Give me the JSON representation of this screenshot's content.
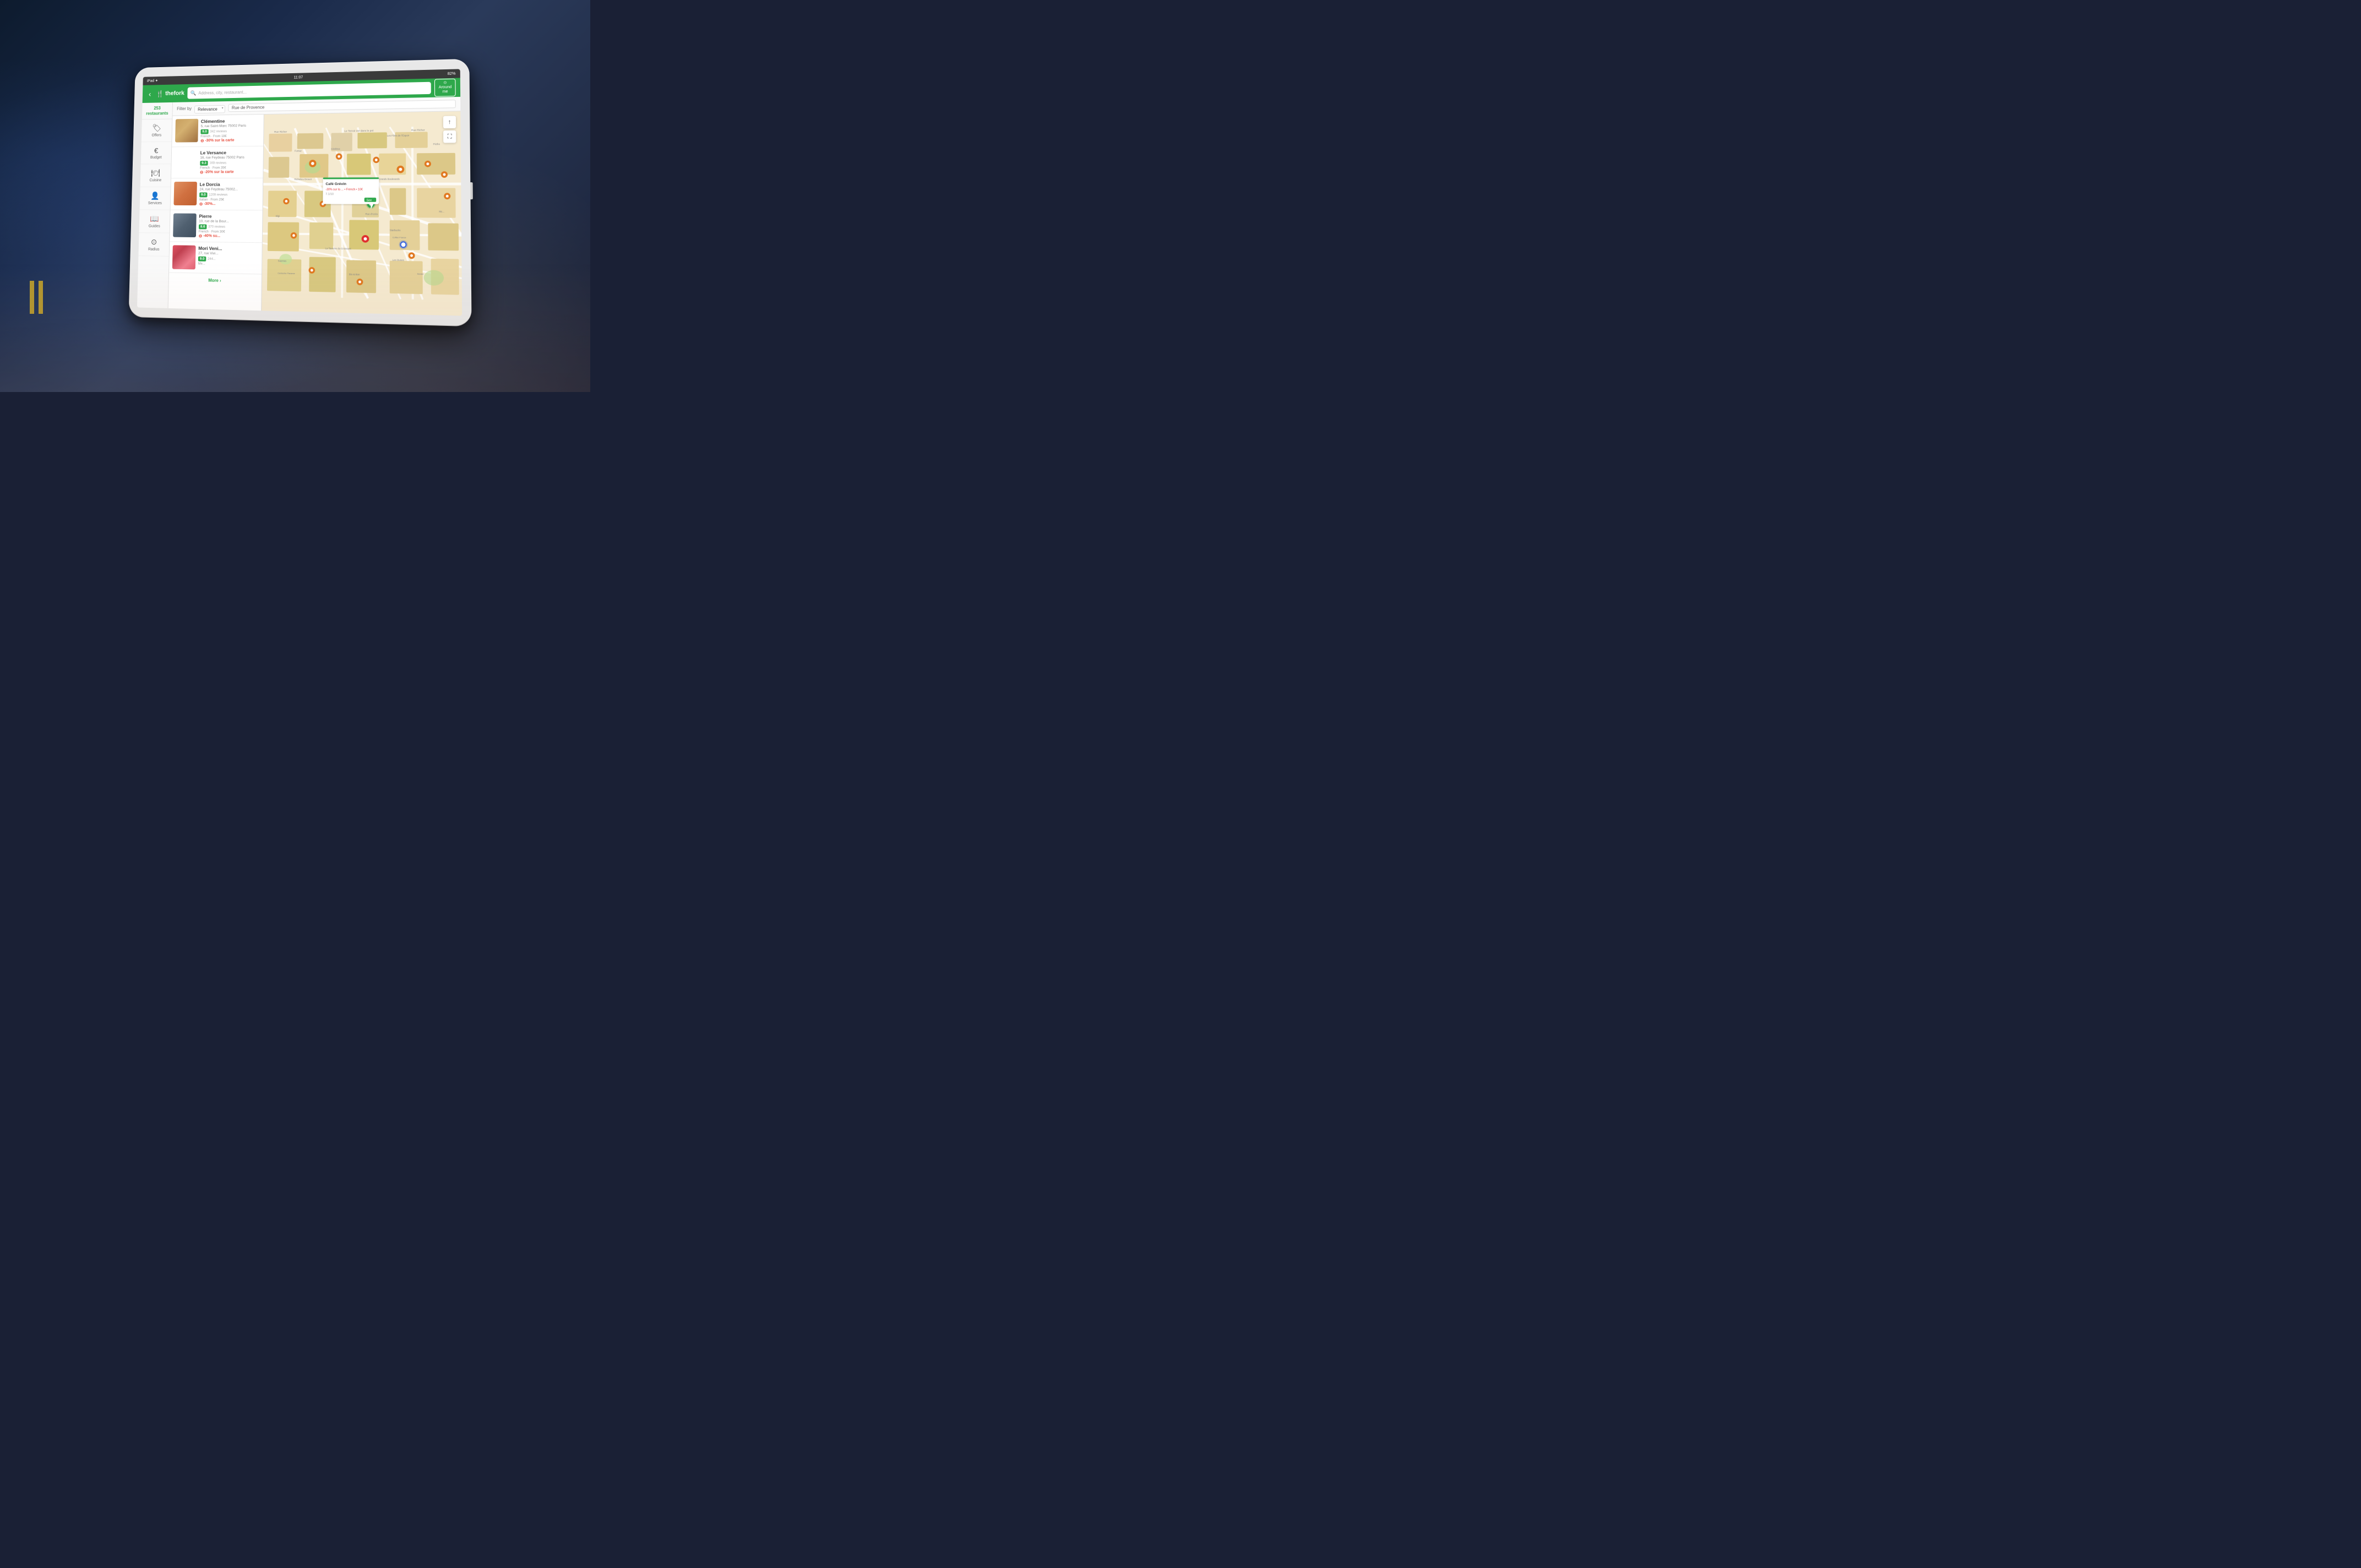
{
  "meta": {
    "dimensions": "4288x2848",
    "description": "TheFork restaurant app on iPad held by hands in a night street scene"
  },
  "status_bar": {
    "device": "iPad ✦",
    "time": "11:07",
    "signal": "▲▲▲",
    "battery": "82%"
  },
  "nav": {
    "back_icon": "‹",
    "brand_icon": "🍴",
    "brand_name": "thefork",
    "search_placeholder": "Address, city, restaurant...",
    "search_icon": "🔍",
    "around_me_label": "Around\nme",
    "around_me_icon": "⊙"
  },
  "filter_bar": {
    "filter_label": "Filter by",
    "relevance_label": "Relevance",
    "address_value": "Rue de Provence"
  },
  "sidebar": {
    "count": "253",
    "count_label": "restaurants",
    "items": [
      {
        "id": "offers",
        "icon": "🏷",
        "label": "Offers"
      },
      {
        "id": "budget",
        "icon": "€",
        "label": "Budget"
      },
      {
        "id": "cuisine",
        "icon": "🍽",
        "label": "Cuisine"
      },
      {
        "id": "services",
        "icon": "👤",
        "label": "Services"
      },
      {
        "id": "guides",
        "icon": "📖",
        "label": "Guides"
      },
      {
        "id": "radius",
        "icon": "⊙",
        "label": "Radius"
      }
    ]
  },
  "restaurants": [
    {
      "id": "clementine",
      "name": "Clémentine",
      "address": "5, rue Saint-Marc 75002 Paris",
      "rating": "9.0",
      "reviews": "342 reviews",
      "cuisine": "French · From 18€",
      "discount": "-30% sur la carte",
      "thumb_class": "thumb-clem"
    },
    {
      "id": "le-versance",
      "name": "Le Versance",
      "address": "16, rue Feydeau 75002 Paris",
      "rating": "9.3",
      "reviews": "169 reviews",
      "cuisine": "French · From 35€",
      "discount": "-20% sur la carte",
      "thumb_class": "thumb-vers"
    },
    {
      "id": "le-dorcia",
      "name": "Le Dorcia",
      "address": "24, rue Feydeau 75002...",
      "rating": "9.0",
      "reviews": "1209 reviews",
      "cuisine": "Italian · From 25€",
      "discount": "-30%...",
      "thumb_class": "thumb-dor"
    },
    {
      "id": "pierre",
      "name": "Pierre",
      "address": "10, rue de la Bour...",
      "rating": "8.6",
      "reviews": "370 reviews",
      "cuisine": "French · From 30€",
      "discount": "-40% su...",
      "thumb_class": "thumb-pier"
    },
    {
      "id": "mori-venice",
      "name": "Mori Veni...",
      "address": "27, rue Vivi...",
      "rating": "9.0",
      "reviews": "244...",
      "cuisine": "Me...",
      "discount": "",
      "thumb_class": "thumb-mori"
    }
  ],
  "more_button": "More ›",
  "map": {
    "tooltip": {
      "name": "Café Grévin",
      "discount": "-30% sur la ... • French • 10€",
      "details": "7.1/10",
      "see_label": "See"
    },
    "controls": {
      "compass_icon": "↑",
      "expand_icon": "⛶"
    },
    "labels": [
      "Rue Richer",
      "Le Terroir",
      "Les Films de",
      "Fumaz",
      "CinéDoc",
      "Starbucks",
      "Coffee France",
      "La Taverne du Croissant",
      "Les Dunes",
      "Rue des",
      "Saemes",
      "Centoche Paname",
      "Bio & Bon",
      "Senter",
      "Grands Boulevards",
      "Elgi",
      "Richelieu Drouot",
      "Rue d'Uzès",
      "Starbucks",
      "Mc..."
    ]
  }
}
